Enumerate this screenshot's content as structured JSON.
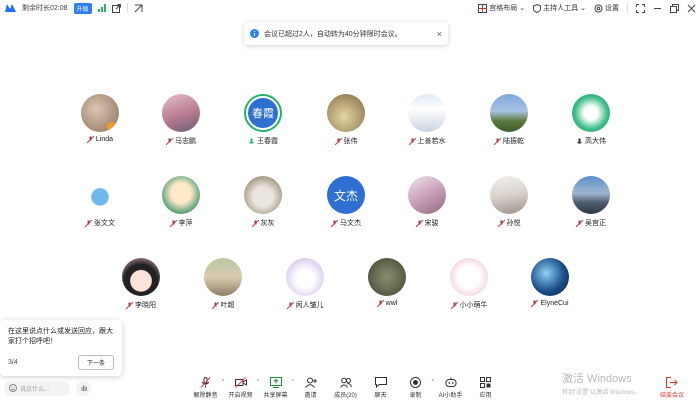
{
  "topbar": {
    "timer": "剩余时长02:08",
    "upgrade": "升级",
    "layout": "宫格布局",
    "host_tools": "主持人工具",
    "settings": "设置"
  },
  "toast": {
    "text": "会议已超过2人，自动转为40分钟限时会议。"
  },
  "participants_row1": [
    "Linda",
    "马志鹏",
    "王春霞",
    "张伟",
    "上善若水",
    "陆振乾",
    "高大伟"
  ],
  "participants_row2": [
    "张文文",
    "李萍",
    "灰灰",
    "马文杰",
    "宋骏",
    "孙悦",
    "吴官正"
  ],
  "participants_row3": [
    "李晓阳",
    "叶超",
    "闲人皱儿",
    "wwl",
    "小小萌牛",
    "ElyneCui"
  ],
  "avatar_text": {
    "wang": "春霞",
    "ma": "文杰"
  },
  "tip": {
    "text": "在这里说点什么或发送回应，跟大家打个招呼吧！",
    "count": "3/4",
    "next": "下一条"
  },
  "chat": {
    "placeholder": "说点什么..."
  },
  "toolbar": {
    "mute": "解除静音",
    "video": "开启视频",
    "share": "共享屏幕",
    "invite": "邀请",
    "members": "成员(20)",
    "chat": "聊天",
    "record": "录制",
    "ai": "AI小助手",
    "apps": "应用",
    "end": "结束会议"
  },
  "watermark": {
    "line1": "激活 Windows",
    "line2": "转到\"设置\"以激活 Windows。"
  },
  "colors": {
    "accent": "#2d7ef7",
    "danger": "#e5322d",
    "speaking": "#27b26a"
  }
}
